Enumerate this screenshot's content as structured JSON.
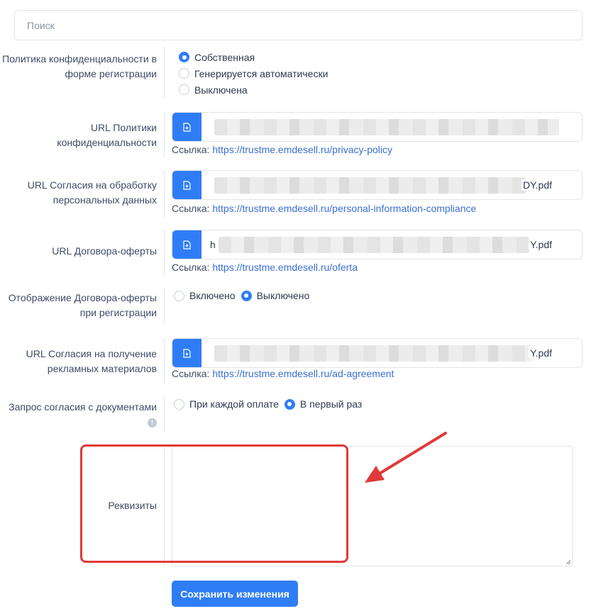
{
  "search": {
    "placeholder": "Поиск"
  },
  "privacy_policy": {
    "label": "Политика конфиденциальности в форме регистрации",
    "options": [
      {
        "label": "Собственная",
        "selected": true
      },
      {
        "label": "Генерируется автоматически",
        "selected": false
      },
      {
        "label": "Выключена",
        "selected": false
      }
    ]
  },
  "privacy_url": {
    "label": "URL Политики конфиденциальности",
    "value_tail": "",
    "link_prefix": "Ссылка:",
    "link": "https://trustme.emdesell.ru/privacy-policy"
  },
  "personal_data_url": {
    "label": "URL Согласия на обработку персональных данных",
    "value_tail": "DY.pdf",
    "link_prefix": "Ссылка:",
    "link": "https://trustme.emdesell.ru/personal-information-compliance"
  },
  "offer_url": {
    "label": "URL Договора-оферты",
    "value_head": "h",
    "value_tail": "Y.pdf",
    "link_prefix": "Ссылка:",
    "link": "https://trustme.emdesell.ru/oferta"
  },
  "offer_display": {
    "label": "Отображение Договора-оферты при регистрации",
    "options": [
      {
        "label": "Включено",
        "selected": false
      },
      {
        "label": "Выключено",
        "selected": true
      }
    ]
  },
  "ads_url": {
    "label": "URL Согласия на получение рекламных материалов",
    "value_tail": "Y.pdf",
    "link_prefix": "Ссылка:",
    "link": "https://trustme.emdesell.ru/ad-agreement"
  },
  "consent_request": {
    "label": "Запрос согласия с документами",
    "info_glyph": "!",
    "options": [
      {
        "label": "При каждой оплате",
        "selected": false
      },
      {
        "label": "В первый раз",
        "selected": true
      }
    ]
  },
  "requisites": {
    "label": "Реквизиты",
    "value": ""
  },
  "save_button": {
    "label": "Сохранить изменения"
  },
  "colors": {
    "accent": "#2f7df6",
    "link": "#3b6fd1",
    "annotation": "#e03a3a"
  }
}
